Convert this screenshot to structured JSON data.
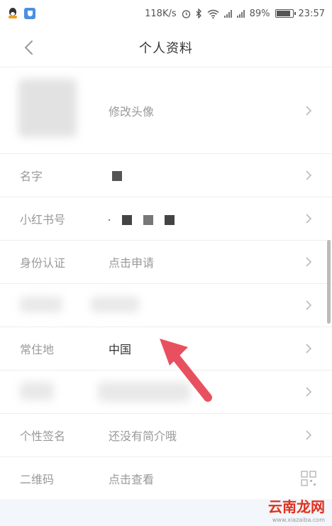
{
  "status_bar": {
    "speed": "118K/s",
    "battery": "89%",
    "battery_level": 0.89,
    "time": "23:57",
    "icons": [
      "qq-icon",
      "shield-icon",
      "alarm-icon",
      "bluetooth-icon",
      "wifi-icon",
      "signal-icon",
      "signal-icon",
      "battery-icon"
    ]
  },
  "header": {
    "title": "个人资料",
    "back_icon": "chevron-left-icon"
  },
  "rows": {
    "avatar": {
      "value": "修改头像"
    },
    "name": {
      "label": "名字"
    },
    "account": {
      "label": "小红书号"
    },
    "identity": {
      "label": "身份认证",
      "value": "点击申请"
    },
    "location": {
      "label": "常住地",
      "value": "中国"
    },
    "bio": {
      "label": "个性签名",
      "value": "还没有简介哦"
    },
    "qrcode": {
      "label": "二维码",
      "value": "点击查看"
    }
  },
  "colors": {
    "arrow": "#e9505f",
    "label": "#999999",
    "value_dark": "#333333",
    "divider": "#eeeeee"
  },
  "watermark": {
    "text": "云南龙网",
    "sub": "www.xiazaiba.com"
  }
}
